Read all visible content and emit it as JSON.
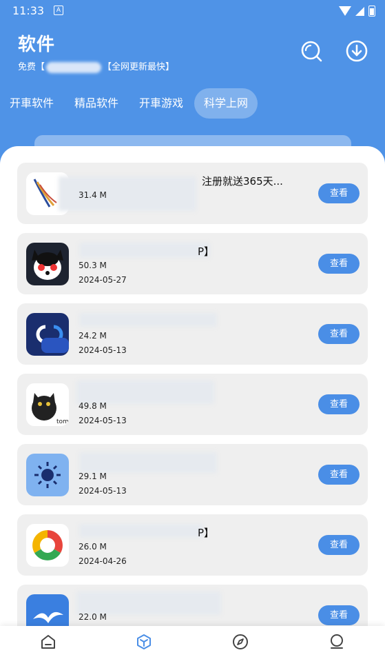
{
  "status_bar": {
    "time": "11:33",
    "a_glyph": "A"
  },
  "header": {
    "title": "软件",
    "subtitle_prefix": "免费【",
    "subtitle_suffix": "【全网更新最快】"
  },
  "tabs": [
    {
      "label": "开車软件",
      "active": false
    },
    {
      "label": "精品软件",
      "active": false
    },
    {
      "label": "开車游戏",
      "active": false
    },
    {
      "label": "科学上网",
      "active": true
    }
  ],
  "apps": [
    {
      "name_tail": "注册就送365天...",
      "size": "31.4 M",
      "date": "",
      "button": "查看",
      "icon": "feather-logo-icon"
    },
    {
      "name_tail": "P】",
      "size": "50.3 M",
      "date": "2024-05-27",
      "button": "查看",
      "icon": "husky-icon"
    },
    {
      "name_tail": "",
      "size": "24.2 M",
      "date": "2024-05-13",
      "button": "查看",
      "icon": "cc-link-icon"
    },
    {
      "name_tail": "",
      "size": "49.8 M",
      "date": "2024-05-13",
      "button": "查看",
      "icon": "tom-cat-icon"
    },
    {
      "name_tail": "",
      "size": "29.1 M",
      "date": "2024-05-13",
      "button": "查看",
      "icon": "dark-sun-icon"
    },
    {
      "name_tail": "P】",
      "size": "26.0 M",
      "date": "2024-04-26",
      "button": "查看",
      "icon": "chrome-ring-icon"
    },
    {
      "name_tail": "",
      "size": "22.0 M",
      "date": "",
      "button": "查看",
      "icon": "seagull-icon"
    }
  ],
  "colors": {
    "primary": "#4f93e7",
    "button": "#4a8ee6",
    "card": "#efefef",
    "nav_active": "#4a8ee6"
  },
  "bottom_nav": [
    {
      "icon": "home-icon",
      "active": false
    },
    {
      "icon": "cube-icon",
      "active": true
    },
    {
      "icon": "compass-icon",
      "active": false
    },
    {
      "icon": "profile-icon",
      "active": false
    }
  ]
}
